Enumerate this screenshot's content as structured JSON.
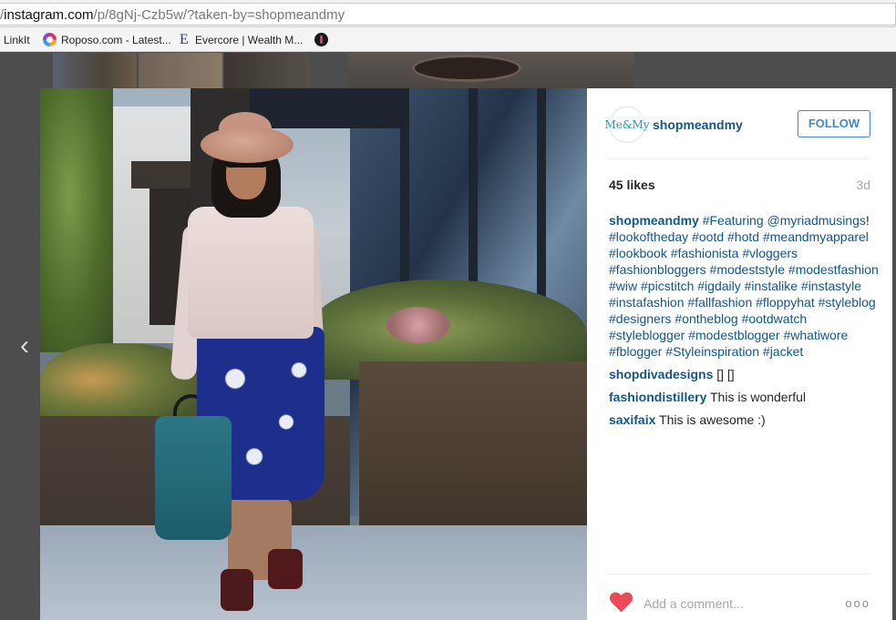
{
  "browser": {
    "url_prefix": "/",
    "url_host": "instagram.com",
    "url_path": "/p/8gNj-Czb5w/?taken-by=shopmeandmy",
    "bookmarks": [
      {
        "label": "LinkIt",
        "icon": "none"
      },
      {
        "label": "Roposo.com - Latest...",
        "icon": "roposo-logo"
      },
      {
        "label": "Evercore | Wealth M...",
        "icon": "evercore-logo"
      },
      {
        "label": "",
        "icon": "pinterest-logo"
      }
    ]
  },
  "post": {
    "author": "shopmeandmy",
    "avatar_text": "Me&My",
    "follow_label": "FOLLOW",
    "likes": "45 likes",
    "time_ago": "3d",
    "caption_user": "shopmeandmy",
    "caption_parts": [
      {
        "t": " ",
        "tag": false
      },
      {
        "t": "#Featuring",
        "tag": true
      },
      {
        "t": " ",
        "tag": false
      },
      {
        "t": "@myriadmusings",
        "tag": true
      },
      {
        "t": "! ",
        "tag": false
      },
      {
        "t": "#lookoftheday",
        "tag": true
      },
      {
        "t": " ",
        "tag": false
      },
      {
        "t": "#ootd",
        "tag": true
      },
      {
        "t": " ",
        "tag": false
      },
      {
        "t": "#hotd",
        "tag": true
      },
      {
        "t": " ",
        "tag": false
      },
      {
        "t": "#meandmyapparel",
        "tag": true
      },
      {
        "t": " ",
        "tag": false
      },
      {
        "t": "#lookbook",
        "tag": true
      },
      {
        "t": " ",
        "tag": false
      },
      {
        "t": "#fashionista",
        "tag": true
      },
      {
        "t": " ",
        "tag": false
      },
      {
        "t": "#vloggers",
        "tag": true
      },
      {
        "t": " ",
        "tag": false
      },
      {
        "t": "#fashionbloggers",
        "tag": true
      },
      {
        "t": " ",
        "tag": false
      },
      {
        "t": "#modeststyle",
        "tag": true
      },
      {
        "t": " ",
        "tag": false
      },
      {
        "t": "#modestfashion",
        "tag": true
      },
      {
        "t": " ",
        "tag": false
      },
      {
        "t": "#wiw",
        "tag": true
      },
      {
        "t": " ",
        "tag": false
      },
      {
        "t": "#picstitch",
        "tag": true
      },
      {
        "t": " ",
        "tag": false
      },
      {
        "t": "#igdaily",
        "tag": true
      },
      {
        "t": " ",
        "tag": false
      },
      {
        "t": "#instalike",
        "tag": true
      },
      {
        "t": " ",
        "tag": false
      },
      {
        "t": "#instastyle",
        "tag": true
      },
      {
        "t": " ",
        "tag": false
      },
      {
        "t": "#instafashion",
        "tag": true
      },
      {
        "t": " ",
        "tag": false
      },
      {
        "t": "#fallfashion",
        "tag": true
      },
      {
        "t": " ",
        "tag": false
      },
      {
        "t": "#floppyhat",
        "tag": true
      },
      {
        "t": " ",
        "tag": false
      },
      {
        "t": "#styleblog",
        "tag": true
      },
      {
        "t": " ",
        "tag": false
      },
      {
        "t": "#designers",
        "tag": true
      },
      {
        "t": " ",
        "tag": false
      },
      {
        "t": "#ontheblog",
        "tag": true
      },
      {
        "t": " ",
        "tag": false
      },
      {
        "t": "#ootdwatch",
        "tag": true
      },
      {
        "t": " ",
        "tag": false
      },
      {
        "t": "#styleblogger",
        "tag": true
      },
      {
        "t": " ",
        "tag": false
      },
      {
        "t": "#modestblogger",
        "tag": true
      },
      {
        "t": " ",
        "tag": false
      },
      {
        "t": "#whatiwore",
        "tag": true
      },
      {
        "t": " ",
        "tag": false
      },
      {
        "t": "#fblogger",
        "tag": true
      },
      {
        "t": " ",
        "tag": false
      },
      {
        "t": "#Styleinspiration",
        "tag": true
      },
      {
        "t": " ",
        "tag": false
      },
      {
        "t": "#jacket",
        "tag": true
      }
    ],
    "comments": [
      {
        "user": "shopdivadesigns",
        "text": " [] []"
      },
      {
        "user": "fashiondistillery",
        "text": " This is wonderful"
      },
      {
        "user": "saxifaix",
        "text": " This is awesome :)"
      }
    ],
    "add_comment_placeholder": "Add a comment...",
    "more_label": "ooo",
    "prev_label": "‹"
  },
  "colors": {
    "link": "#125688",
    "follow": "#3f89c6",
    "heart": "#ed4956",
    "muted": "#a5a7aa"
  }
}
